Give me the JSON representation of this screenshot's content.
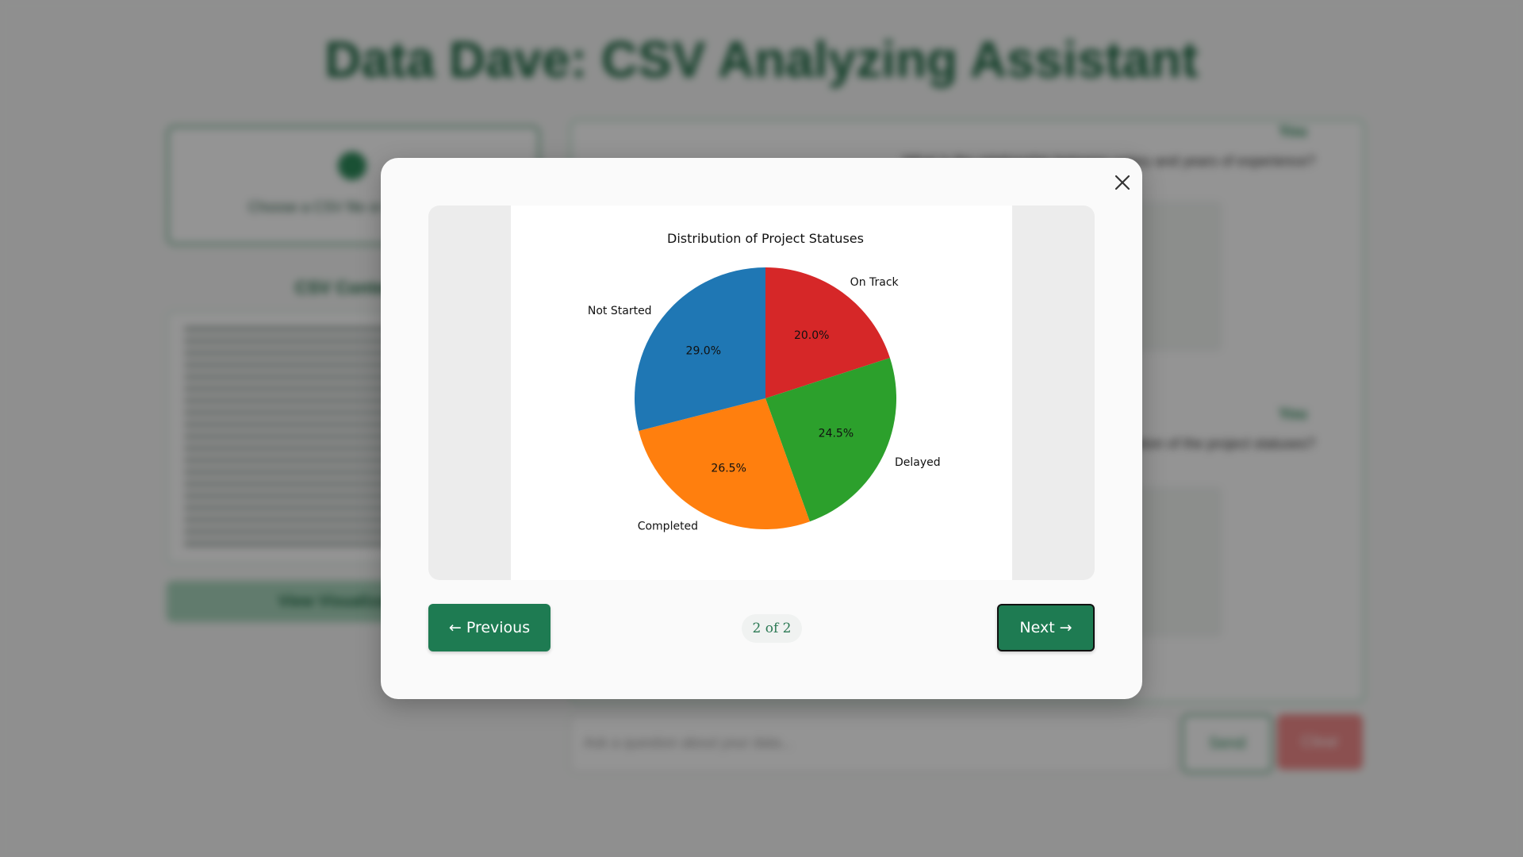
{
  "app": {
    "title": "Data Dave: CSV Analyzing Assistant",
    "upload_text": "Choose a CSV file or drag it here",
    "csv_heading": "CSV Content",
    "visualize_label": "View Visualizations",
    "chat": {
      "messages": [
        {
          "sender": "You",
          "text": "What is the relationship between salary and years of experience?"
        },
        {
          "sender": "You",
          "text": "What is the distribution of the project statuses?"
        }
      ],
      "input_placeholder": "Ask a question about your data...",
      "send_label": "Send",
      "clear_label": "Clear"
    }
  },
  "modal": {
    "prev_label": "← Previous",
    "next_label": "Next →",
    "page_indicator": "2 of 2",
    "icons": {
      "close": "close-icon"
    }
  },
  "colors": {
    "accent": "#1e7b52",
    "on_track": "#d62728",
    "delayed": "#2ca02c",
    "completed": "#ff7f0e",
    "not_started": "#1f77b4"
  },
  "chart_data": {
    "type": "pie",
    "title": "Distribution of Project Statuses",
    "start_angle": 90,
    "direction": "clockwise",
    "slices": [
      {
        "label": "On Track",
        "value": 20.0,
        "pct_label": "20.0%",
        "color": "#d62728"
      },
      {
        "label": "Delayed",
        "value": 24.5,
        "pct_label": "24.5%",
        "color": "#2ca02c"
      },
      {
        "label": "Completed",
        "value": 26.5,
        "pct_label": "26.5%",
        "color": "#ff7f0e"
      },
      {
        "label": "Not Started",
        "value": 29.0,
        "pct_label": "29.0%",
        "color": "#1f77b4"
      }
    ]
  }
}
